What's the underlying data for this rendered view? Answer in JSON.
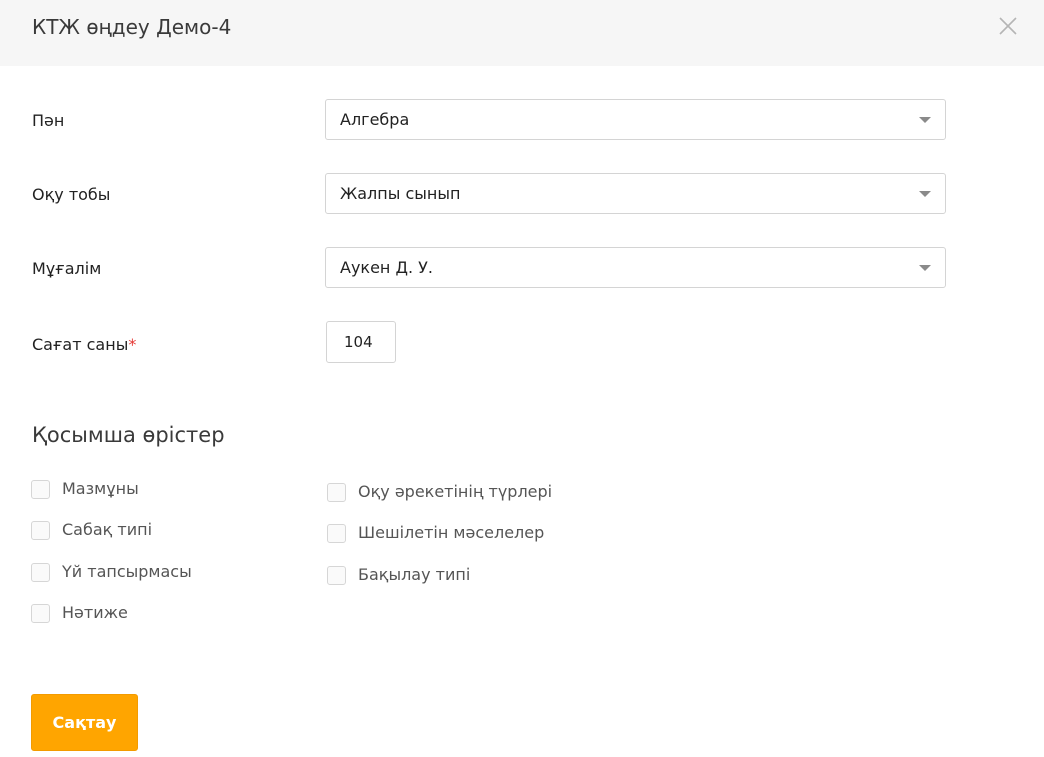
{
  "dialog": {
    "title": "КТЖ өңдеу Демо-4"
  },
  "form": {
    "subject": {
      "label": "Пән",
      "value": "Алгебра"
    },
    "group": {
      "label": "Оқу тобы",
      "value": "Жалпы сынып"
    },
    "teacher": {
      "label": "Мұғалім",
      "value": "Аукен Д. У."
    },
    "hours": {
      "label": "Сағат саны",
      "required_mark": "*",
      "value": "104"
    }
  },
  "extra_fields": {
    "title": "Қосымша өрістер",
    "left_column": [
      {
        "label": "Мазмұны",
        "checked": false
      },
      {
        "label": "Сабақ типі",
        "checked": false
      },
      {
        "label": "Үй тапсырмасы",
        "checked": false
      },
      {
        "label": "Нәтиже",
        "checked": false
      }
    ],
    "right_column": [
      {
        "label": "Оқу әрекетінің түрлері",
        "checked": false
      },
      {
        "label": "Шешілетін мәселелер",
        "checked": false
      },
      {
        "label": "Бақылау типі",
        "checked": false
      }
    ]
  },
  "actions": {
    "save_label": "Сақтау"
  },
  "colors": {
    "accent": "#ffa500",
    "header_bg": "#f6f6f6",
    "required": "#e53935"
  }
}
